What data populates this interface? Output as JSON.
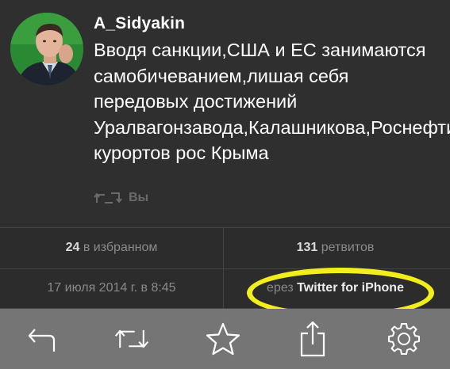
{
  "tweet": {
    "username": "A_Sidyakin",
    "text": "Вводя санкции,США и ЕС занимаются самобичеванием,лишая себя передовых достижений Уралвагонзавода,Калашникова,Роснефти.., курортов рос Крыма",
    "retweeted_by": "Вы",
    "avatar_icon": "user-photo-avatar"
  },
  "stats": {
    "favorites_count": "24",
    "favorites_label": " в избранном",
    "retweets_count": "131",
    "retweets_label": " ретвитов",
    "date": "17 июля 2014 г. в 8:45",
    "source_prefix": "ерез ",
    "source_app": "Twitter for iPhone"
  },
  "annotation": {
    "highlight_color": "#f1ee1c"
  },
  "toolbar": {
    "icons": [
      "reply-icon",
      "retweet-icon",
      "favorite-star-icon",
      "share-icon",
      "settings-gear-icon"
    ]
  },
  "colors": {
    "background": "#2f2f2f",
    "toolbar": "#757575",
    "text": "#ffffff",
    "muted": "#8a8a8a"
  }
}
